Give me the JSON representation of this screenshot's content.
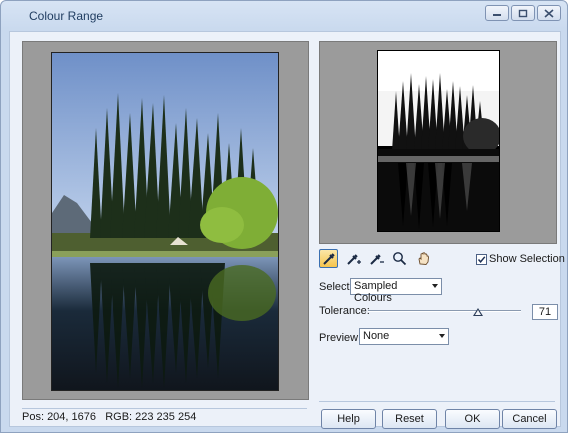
{
  "window": {
    "title": "Colour Range"
  },
  "status": {
    "pos": "Pos: 204, 1676",
    "rgb": "RGB: 223 235 254"
  },
  "options": {
    "show_selection": "Show Selection",
    "show_selection_checked": true,
    "select_label": "Select:",
    "select_value": "Sampled Colours",
    "tolerance_label": "Tolerance:",
    "tolerance_value": "71",
    "preview_label": "Preview:",
    "preview_value": "None"
  },
  "tools": [
    "eyedropper-icon",
    "eyedropper-plus-icon",
    "eyedropper-minus-icon",
    "zoom-icon",
    "hand-icon"
  ],
  "buttons": {
    "help": "Help",
    "reset": "Reset",
    "ok": "OK",
    "cancel": "Cancel"
  }
}
